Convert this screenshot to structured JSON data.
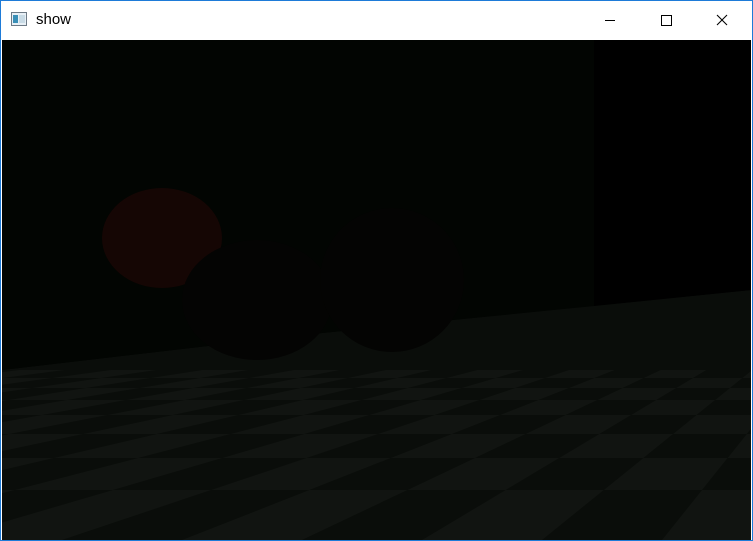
{
  "window": {
    "title": "show",
    "app_icon": "window-app-icon",
    "controls": {
      "minimize_icon": "minimize-icon",
      "maximize_icon": "maximize-icon",
      "close_icon": "close-icon"
    }
  },
  "scene": {
    "description_icon": "render-viewport",
    "colors": {
      "background_left": "#020502",
      "background_right": "#000000",
      "floor_dark": "#0a0d0a",
      "floor_light": "#111411",
      "sphere_red": "#1a0604",
      "sphere_dark": "#050403",
      "frame_border": "#1e7bd8"
    }
  }
}
